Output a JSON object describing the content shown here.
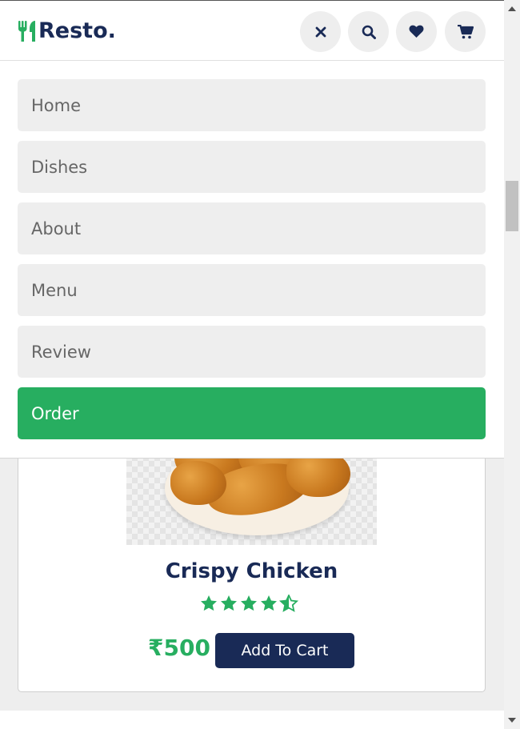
{
  "header": {
    "logo_text": "Resto.",
    "logo_icon": "utensils-icon",
    "buttons": [
      {
        "icon": "close-icon"
      },
      {
        "icon": "search-icon"
      },
      {
        "icon": "heart-icon"
      },
      {
        "icon": "cart-icon"
      }
    ]
  },
  "menu": {
    "items": [
      {
        "label": "Home"
      },
      {
        "label": "Dishes"
      },
      {
        "label": "About"
      },
      {
        "label": "Menu"
      },
      {
        "label": "Review"
      },
      {
        "label": "Order"
      }
    ],
    "active": "Order"
  },
  "card": {
    "title": "Crispy Chicken",
    "rating": 4.5,
    "rating_max": 5,
    "price": "₹500",
    "button_label": "Add To Cart"
  },
  "colors": {
    "accent": "#27ae60",
    "primary": "#192a56",
    "light_bg": "#eeeeee"
  }
}
